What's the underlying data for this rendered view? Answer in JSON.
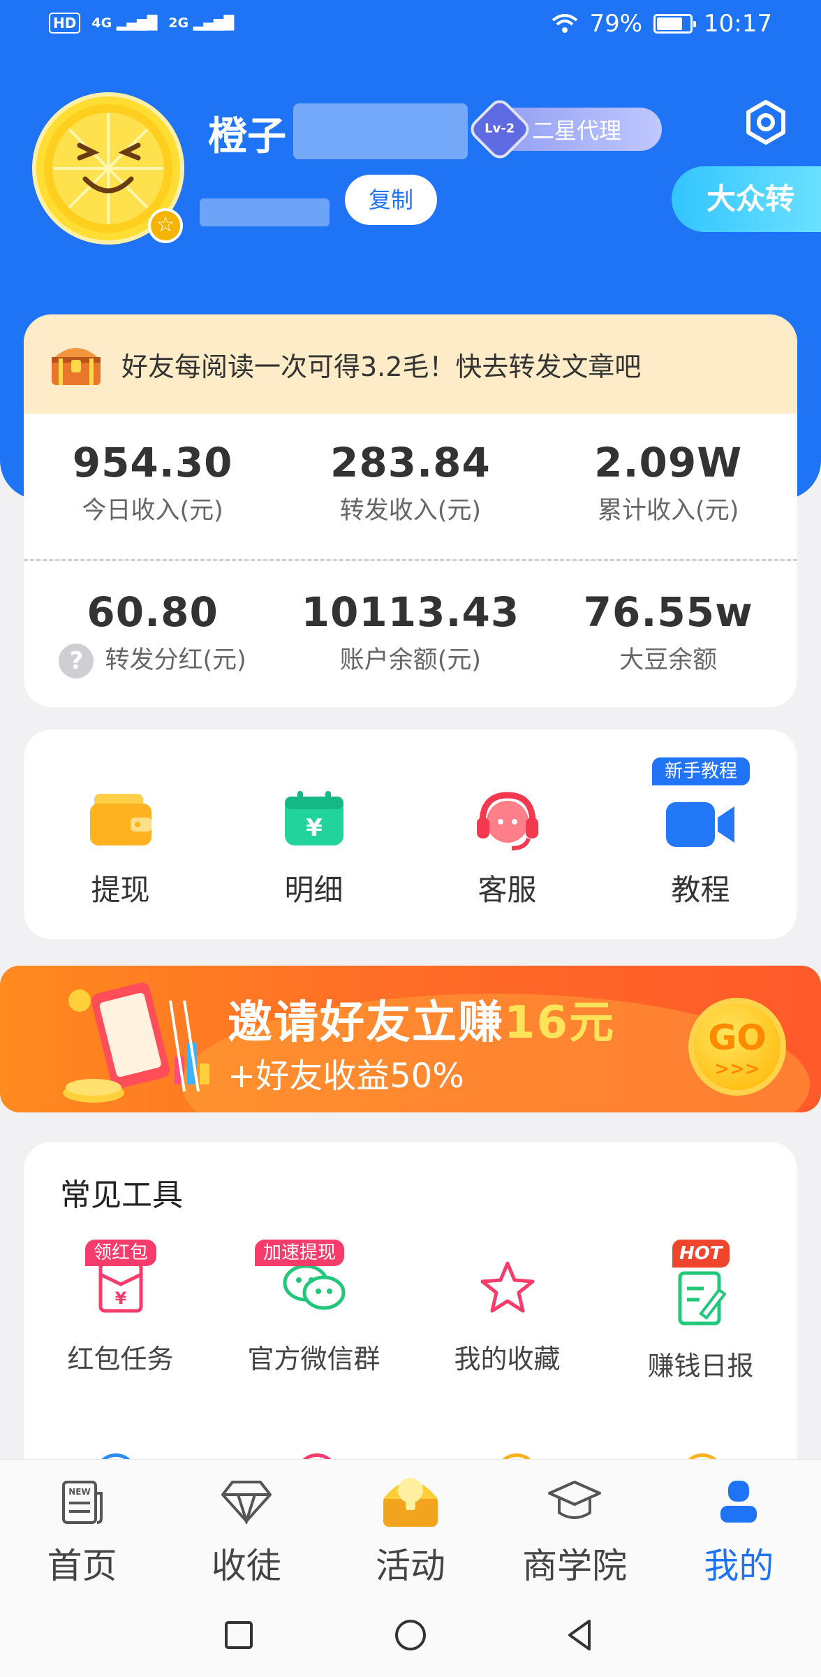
{
  "status_bar": {
    "hd": "HD",
    "signal1": "4G",
    "signal2": "2G",
    "battery_text": "79%",
    "battery_level": 0.79,
    "time": "10:17"
  },
  "profile": {
    "name": "橙子",
    "rank": "二星代理",
    "level": "Lv-2",
    "copy_label": "复制",
    "tag_button": "大众转"
  },
  "notice": {
    "text": "好友每阅读一次可得3.2毛！快去转发文章吧"
  },
  "stats": {
    "row1": [
      {
        "value": "954.30",
        "label": "今日收入(元)"
      },
      {
        "value": "283.84",
        "label": "转发收入(元)"
      },
      {
        "value": "2.09W",
        "label": "累计收入(元)"
      }
    ],
    "row2": [
      {
        "value": "60.80",
        "label": "转发分红(元)"
      },
      {
        "value": "10113.43",
        "label": "账户余额(元)"
      },
      {
        "value": "76.55w",
        "label": "大豆余额"
      }
    ]
  },
  "actions": [
    {
      "label": "提现",
      "icon": "wallet-icon"
    },
    {
      "label": "明细",
      "icon": "calendar-yen-icon"
    },
    {
      "label": "客服",
      "icon": "headset-icon"
    },
    {
      "label": "教程",
      "icon": "video-camera-icon"
    }
  ],
  "newbie_tag": "新手教程",
  "banner": {
    "title_prefix": "邀请好友立赚",
    "title_highlight": "16元",
    "subtitle": "+好友收益50%",
    "go": "GO",
    "arrows": ">>>"
  },
  "tools": {
    "title": "常见工具",
    "items": [
      {
        "label": "红包任务",
        "tag": "领红包",
        "icon": "red-envelope-icon"
      },
      {
        "label": "官方微信群",
        "tag": "加速提现",
        "icon": "wechat-icon"
      },
      {
        "label": "我的收藏",
        "tag": "",
        "icon": "star-icon"
      },
      {
        "label": "赚钱日报",
        "tag": "HOT",
        "icon": "report-edit-icon"
      }
    ]
  },
  "bottom_nav": [
    {
      "label": "首页",
      "icon": "news-icon"
    },
    {
      "label": "收徒",
      "icon": "diamond-icon"
    },
    {
      "label": "活动",
      "icon": "treasure-chest-icon"
    },
    {
      "label": "商学院",
      "icon": "graduation-cap-icon"
    },
    {
      "label": "我的",
      "icon": "user-icon",
      "active": true
    }
  ],
  "colors": {
    "primary": "#1f74f5",
    "notice_bg": "#fdecc7",
    "banner": "#ff6e26"
  }
}
